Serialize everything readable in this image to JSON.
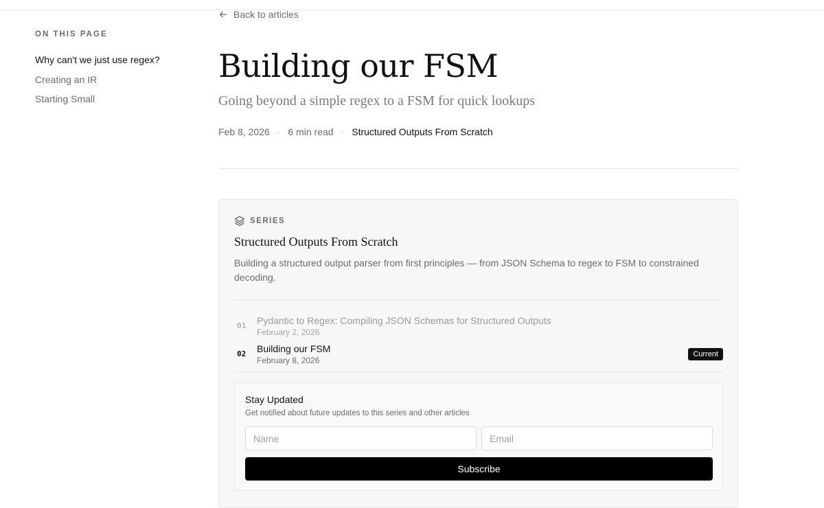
{
  "toc": {
    "heading": "ON THIS PAGE",
    "items": [
      {
        "label": "Why can't we just use regex?"
      },
      {
        "label": "Creating an IR"
      },
      {
        "label": "Starting Small"
      }
    ]
  },
  "article": {
    "back_label": "Back to articles",
    "title": "Building our FSM",
    "subtitle": "Going beyond a simple regex to a FSM for quick lookups",
    "date": "Feb 8, 2026",
    "read_time": "6 min read",
    "series_link": "Structured Outputs From Scratch"
  },
  "series": {
    "label": "SERIES",
    "icon": "layers-icon",
    "title": "Structured Outputs From Scratch",
    "description": "Building a structured output parser from first principles — from JSON Schema to regex to FSM to constrained decoding.",
    "items": [
      {
        "number": "01",
        "title": "Pydantic to Regex: Compiling JSON Schemas for Structured Outputs",
        "date": "February 2, 2026"
      },
      {
        "number": "02",
        "title": "Building our FSM",
        "date": "February 8, 2026",
        "badge": "Current"
      }
    ]
  },
  "subscribe": {
    "title": "Stay Updated",
    "description": "Get notified about future updates to this series and other articles",
    "name_placeholder": "Name",
    "email_placeholder": "Email",
    "button_label": "Subscribe"
  },
  "colors": {
    "accent": "#111111",
    "muted": "#6b6b6b",
    "card_bg": "#f7f7f8",
    "button_bg": "#000000"
  }
}
